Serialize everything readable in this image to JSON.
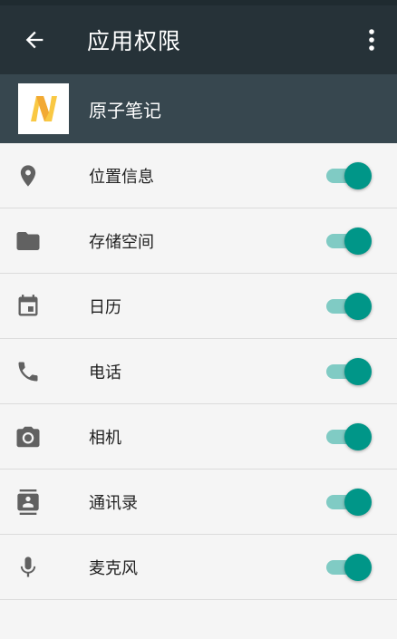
{
  "toolbar": {
    "title": "应用权限",
    "back_icon": "arrow-back-icon",
    "more_icon": "more-vert-icon",
    "background": "#263238"
  },
  "app": {
    "name": "原子笔记",
    "logo_icon": "app-logo-n-icon",
    "logo_color": "#f9c843",
    "background": "#37474f"
  },
  "accent": "#009688",
  "permissions": [
    {
      "label": "位置信息",
      "icon": "location-icon",
      "enabled": true
    },
    {
      "label": "存储空间",
      "icon": "folder-icon",
      "enabled": true
    },
    {
      "label": "日历",
      "icon": "calendar-icon",
      "enabled": true
    },
    {
      "label": "电话",
      "icon": "phone-icon",
      "enabled": true
    },
    {
      "label": "相机",
      "icon": "camera-icon",
      "enabled": true
    },
    {
      "label": "通讯录",
      "icon": "contacts-icon",
      "enabled": true
    },
    {
      "label": "麦克风",
      "icon": "microphone-icon",
      "enabled": true
    }
  ]
}
